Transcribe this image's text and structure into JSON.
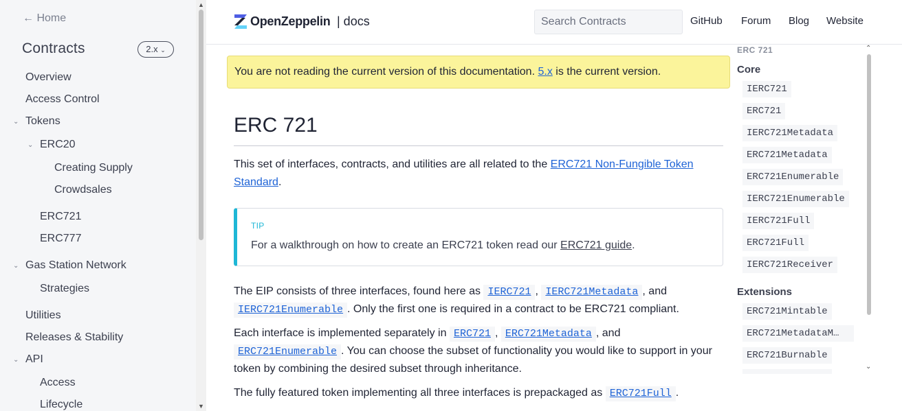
{
  "sidebar": {
    "home": "← Home",
    "title": "Contracts",
    "version": "2.x",
    "items": [
      "Overview",
      "Access Control",
      "Tokens",
      "ERC20",
      "Creating Supply",
      "Crowdsales",
      "ERC721",
      "ERC777",
      "Gas Station Network",
      "Strategies",
      "Utilities",
      "Releases & Stability",
      "API",
      "Access",
      "Lifecycle"
    ]
  },
  "header": {
    "brand": "OpenZeppelin",
    "brand_suffix": "| docs",
    "search_placeholder": "Search Contracts",
    "links": [
      "GitHub",
      "Forum",
      "Blog",
      "Website"
    ]
  },
  "banner": {
    "text_before": "You are not reading the current version of this documentation. ",
    "link": "5.x",
    "text_after": " is the current version."
  },
  "main": {
    "title": "ERC 721",
    "intro_before": "This set of interfaces, contracts, and utilities are all related to the ",
    "intro_link_line1": "ERC721 Non-Fungible Token",
    "intro_link_line2": "Standard",
    "intro_after": ".",
    "tip_label": "TIP",
    "tip_before": "For a walkthrough on how to create an ERC721 token read our ",
    "tip_link": "ERC721 guide",
    "tip_after": ".",
    "p2_a": "The EIP consists of three interfaces, found here as ",
    "p2_code1": "IERC721",
    "p2_sep1": ", ",
    "p2_code2": "IERC721Metadata",
    "p2_sep2": ", and",
    "p2_code3": "IERC721Enumerable",
    "p2_b": ". Only the first one is required in a contract to be ERC721 compliant.",
    "p3_a": "Each interface is implemented separately in ",
    "p3_code1": "ERC721",
    "p3_sep1": ", ",
    "p3_code2": "ERC721Metadata",
    "p3_sep2": ", and",
    "p3_code3": "ERC721Enumerable",
    "p3_b": ". You can choose the subset of functionality you would like to support in your",
    "p3_c": "token by combining the desired subset through inheritance.",
    "p4_a": "The fully featured token implementing all three interfaces is prepackaged as ",
    "p4_code": "ERC721Full",
    "p4_b": "."
  },
  "toc": {
    "top": "ERC 721",
    "core_heading": "Core",
    "core": [
      "IERC721",
      "ERC721",
      "IERC721Metadata",
      "ERC721Metadata",
      "ERC721Enumerable",
      "IERC721Enumerable",
      "IERC721Full",
      "ERC721Full",
      "IERC721Receiver"
    ],
    "ext_heading": "Extensions",
    "extensions": [
      "ERC721Mintable",
      "ERC721MetadataM…",
      "ERC721Burnable"
    ]
  },
  "colors": {
    "accent": "#1eb7d6",
    "link": "#1e63d6",
    "banner_bg": "#fbf49b",
    "sidebar_bg": "#f5f6f8"
  }
}
